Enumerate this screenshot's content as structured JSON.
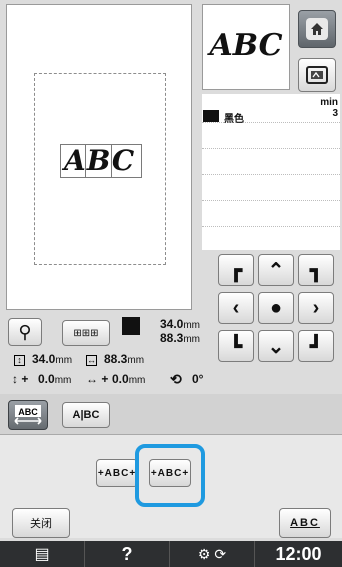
{
  "preview": {
    "main_text": "ABC",
    "thumb_text": "ABC"
  },
  "thread_list": {
    "color_name": "黑色",
    "min_label": "min",
    "min_value": "3"
  },
  "size": {
    "width_value": "34.0",
    "height_value": "88.3",
    "unit": "mm"
  },
  "info_row1": {
    "x_value": "34.0",
    "y_value": "88.3",
    "unit": "mm"
  },
  "info_row2": {
    "x_offset_prefix": "+",
    "x_offset": "0.0",
    "y_offset_prefix": "+",
    "y_offset": "0.0",
    "unit": "mm",
    "angle": "0°"
  },
  "tabs": {
    "tab2_label": "A|BC"
  },
  "spacing": {
    "narrow_label": "+ABC+",
    "wide_label": "+ABC+"
  },
  "buttons": {
    "close_label": "关闭",
    "abc_label": "ABC"
  },
  "statusbar": {
    "help_label": "?",
    "time": "12:00"
  }
}
